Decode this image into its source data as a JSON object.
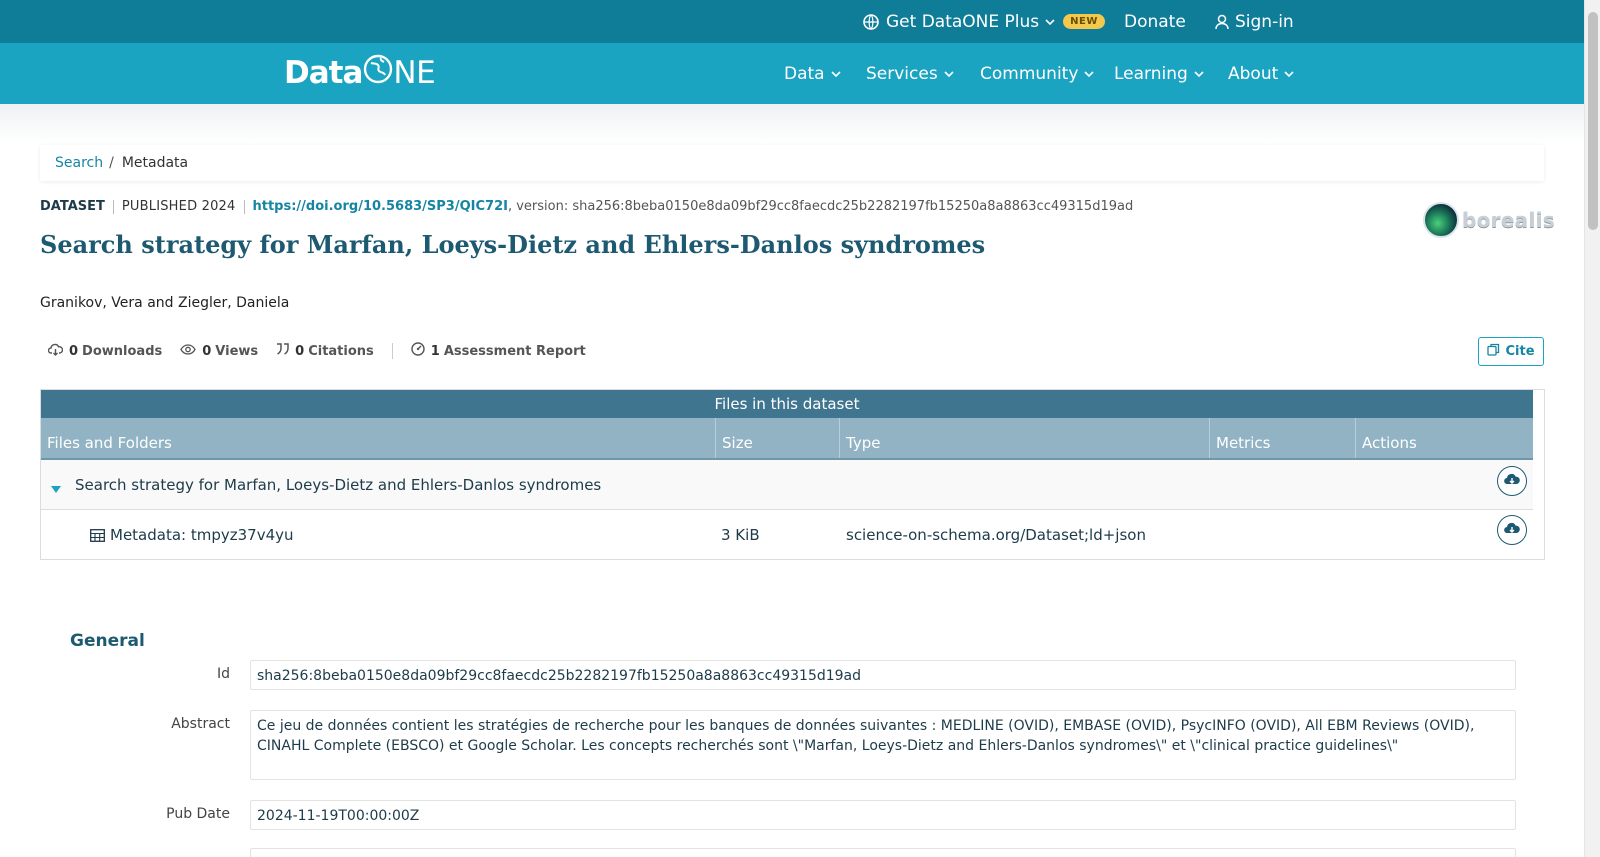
{
  "topbar": {
    "get_plus": "Get DataONE Plus",
    "new_badge": "NEW",
    "donate": "Donate",
    "sign_in": "Sign-in"
  },
  "nav": {
    "logo_a": "Data",
    "logo_b": "NE",
    "items": [
      "Data",
      "Services",
      "Community",
      "Learning",
      "About"
    ]
  },
  "breadcrumb": {
    "search": "Search",
    "separator": "/",
    "current": "Metadata"
  },
  "meta": {
    "type": "DATASET",
    "published": "PUBLISHED 2024",
    "doi": "https://doi.org/10.5683/SP3/QIC72I",
    "version": ", version: sha256:8beba0150e8da09bf29cc8faecdc25b2282197fb15250a8a8863cc49315d19ad"
  },
  "title": "Search strategy for Marfan, Loeys-Dietz and Ehlers-Danlos syndromes",
  "repository": "borealis",
  "authors": "Granikov, Vera and Ziegler, Daniela",
  "stats": {
    "downloads_count": "0",
    "downloads_label": "Downloads",
    "views_count": "0",
    "views_label": "Views",
    "citations_count": "0",
    "citations_label": "Citations",
    "assessment_count": "1",
    "assessment_label": "Assessment Report"
  },
  "cite_label": "Cite",
  "files": {
    "header": "Files in this dataset",
    "columns": [
      "Files and Folders",
      "Size",
      "Type",
      "Metrics",
      "Actions"
    ],
    "folder_name": "Search strategy for Marfan, Loeys-Dietz and Ehlers-Danlos syndromes",
    "file": {
      "name": "Metadata: tmpyz37v4yu",
      "size": "3 KiB",
      "type": "science-on-schema.org/Dataset;ld+json"
    }
  },
  "general": {
    "heading": "General",
    "id_label": "Id",
    "id_value": "sha256:8beba0150e8da09bf29cc8faecdc25b2282197fb15250a8a8863cc49315d19ad",
    "abstract_label": "Abstract",
    "abstract_value": "Ce jeu de données contient les stratégies de recherche pour les banques de données suivantes : MEDLINE (OVID), EMBASE (OVID), PsycINFO (OVID), All EBM Reviews (OVID), CINAHL Complete (EBSCO) et Google Scholar. Les concepts recherchés sont \\\"Marfan, Loeys-Dietz and Ehlers-Danlos syndromes\\\" et \\\"clinical practice guidelines\\\"",
    "pubdate_label": "Pub Date",
    "pubdate_value": "2024-11-19T00:00:00Z"
  },
  "colors": {
    "topbar": "#0f7c98",
    "navbar": "#1ba4c1",
    "accent": "#1685a3",
    "title": "#1d5a72",
    "table_head": "#407590",
    "table_cols": "#91b3c4",
    "badge": "#f2c94c"
  }
}
